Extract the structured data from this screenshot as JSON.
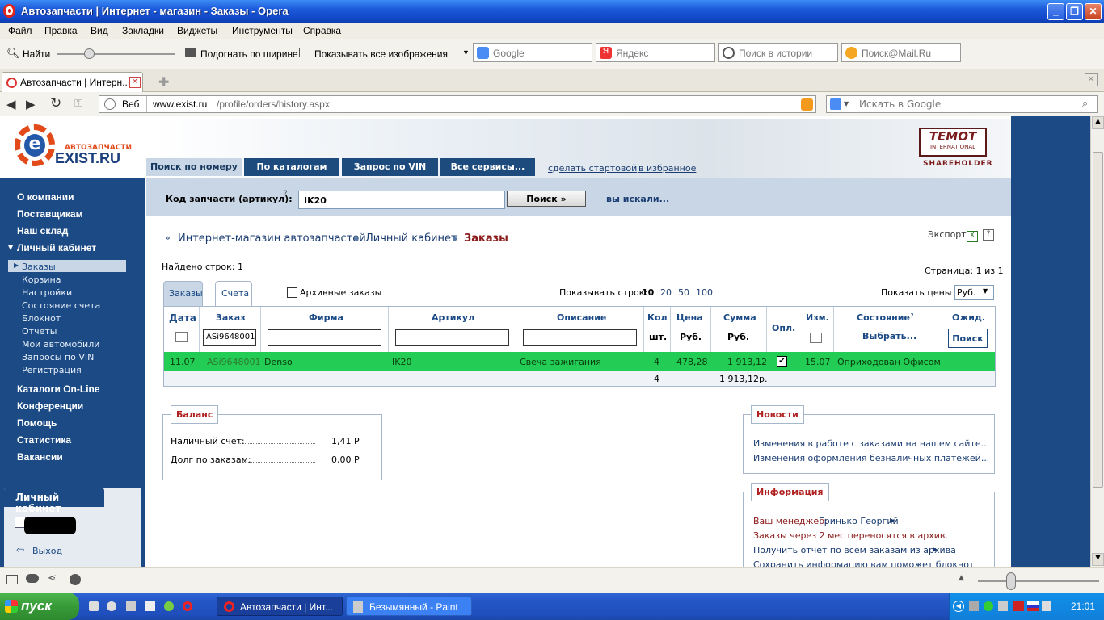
{
  "window": {
    "title": "Автозапчасти | Интернет - магазин - Заказы - Opera"
  },
  "menu": [
    "Файл",
    "Правка",
    "Вид",
    "Закладки",
    "Виджеты",
    "Инструменты",
    "Справка"
  ],
  "toolbar": {
    "find": "Найти",
    "fit_width": "Подогнать по ширине",
    "show_images": "Показывать все изображения",
    "searches": [
      "Google",
      "Яндекс",
      "Поиск в истории",
      "Поиск@Mail.Ru"
    ]
  },
  "tab": {
    "title": "Автозапчасти | Интерн..."
  },
  "address": {
    "web": "Веб",
    "url_host": "www.exist.ru",
    "url_path": "/profile/orders/history.aspx",
    "search_placeholder": "Искать в Google"
  },
  "site": {
    "logo_small": "АВТОЗАПЧАСТИ",
    "logo_big": "EXIST.RU",
    "partner_top": "TEMOT",
    "partner_mid": "INTERNATIONAL",
    "partner_bot": "SHAREHOLDER",
    "nav_tabs": [
      "Поиск по номеру",
      "По каталогам",
      "Запрос по VIN",
      "Все сервисы..."
    ],
    "make_start": "сделать стартовой",
    "favorites": "в избранное",
    "search_label": "Код запчасти (артикул):",
    "search_value": "IK20",
    "search_button": "Поиск »",
    "you_searched": "вы искали...",
    "sidebar_main": [
      "О компании",
      "Поставщикам",
      "Наш склад",
      "Личный кабинет"
    ],
    "sidebar_sub": [
      "Заказы",
      "Корзина",
      "Настройки",
      "Состояние счета",
      "Блокнот",
      "Отчеты",
      "Мои автомобили",
      "Запросы по VIN",
      "Регистрация"
    ],
    "sidebar_main2": [
      "Каталоги On-Line",
      "Конференции",
      "Помощь",
      "Статистика",
      "Вакансии"
    ],
    "cabinet_title": "Личный кабинет",
    "logout": "Выход"
  },
  "breadcrumb": [
    "Интернет-магазин автозапчастей",
    "Личный кабинет",
    "Заказы"
  ],
  "export": "Экспорт",
  "found_rows": "Найдено строк: 1",
  "page_info": "Страница: 1 из 1",
  "subtabs": [
    "Заказы",
    "Счета"
  ],
  "archive_label": "Архивные заказы",
  "rows_label": "Показывать строк:",
  "rows_options": [
    "10",
    "20",
    "50",
    "100"
  ],
  "price_label": "Показать цены в:",
  "currency": "Руб.",
  "columns": [
    "Дата",
    "Заказ",
    "Фирма",
    "Артикул",
    "Описание",
    "Кол",
    "Цена",
    "Сумма",
    "Опл.",
    "Изм.",
    "Состояние",
    "Ожид."
  ],
  "subheaders": {
    "qty": "шт.",
    "price": "Руб.",
    "sum": "Руб.",
    "state": "Выбрать...",
    "search": "Поиск"
  },
  "filter_order": "ASi9648001",
  "row": {
    "date": "11.07",
    "order": "ASi9648001",
    "firm": "Denso",
    "article": "IK20",
    "desc": "Свеча зажигания",
    "qty": "4",
    "price": "478,28",
    "sum": "1 913,12",
    "changed": "15.07",
    "state": "Оприходован Офисом"
  },
  "totals": {
    "qty": "4",
    "sum": "1 913,12р."
  },
  "balance": {
    "title": "Баланс",
    "cash_label": "Наличный счет:",
    "cash": "1,41 Р",
    "debt_label": "Долг по заказам:",
    "debt": "0,00 Р"
  },
  "news": {
    "title": "Новости",
    "items": [
      "Изменения в работе с заказами на нашем сайте...",
      "Изменения оформления безналичных платежей..."
    ]
  },
  "info": {
    "title": "Информация",
    "manager_label": "Ваш менеджер:",
    "manager": "Гринько Георгий",
    "archive_note": "Заказы через 2 мес переносятся в архив.",
    "report": "Получить отчет по всем заказам из архива",
    "notebook": "Сохранить информацию вам поможет блокнот"
  },
  "taskbar": {
    "start": "пуск",
    "items": [
      "Автозапчасти | Инт...",
      "Безымянный - Paint"
    ],
    "clock": "21:01"
  },
  "colors": {
    "navy": "#1B4A85",
    "green_row": "#22CC55",
    "red": "#B02020"
  }
}
